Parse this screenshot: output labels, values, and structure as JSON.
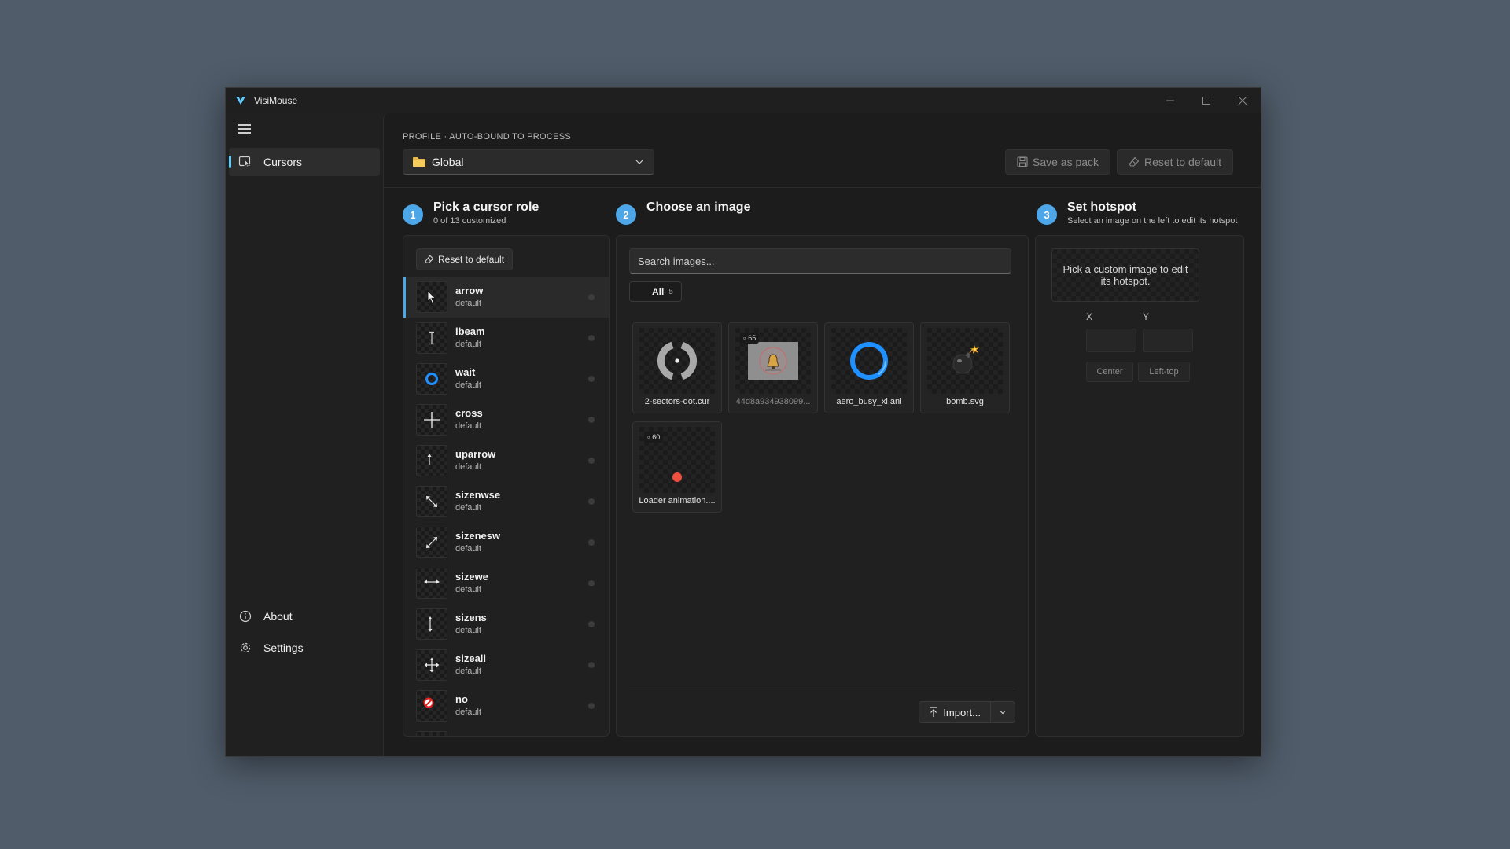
{
  "window": {
    "title": "VisiMouse",
    "accent": "#60cdff",
    "step_color": "#4ca6e8"
  },
  "sidebar": {
    "items": [
      {
        "label": "Cursors",
        "icon": "cursor-image-icon"
      }
    ],
    "footer": [
      {
        "label": "About",
        "icon": "info-icon"
      },
      {
        "label": "Settings",
        "icon": "gear-icon"
      }
    ]
  },
  "profile": {
    "label": "PROFILE · AUTO-BOUND TO PROCESS",
    "selected": "Global",
    "save_label": "Save as pack",
    "reset_label": "Reset to default"
  },
  "steps": [
    {
      "number": "1",
      "title": "Pick a cursor role",
      "subtitle": "0 of 13 customized"
    },
    {
      "number": "2",
      "title": "Choose an image",
      "subtitle": ""
    },
    {
      "number": "3",
      "title": "Set hotspot",
      "subtitle": "Select an image on the left to edit its hotspot"
    }
  ],
  "roles_panel": {
    "reset_label": "Reset to default",
    "roles": [
      {
        "name": "arrow",
        "state": "default",
        "icon": "arrow-cursor-icon"
      },
      {
        "name": "ibeam",
        "state": "default",
        "icon": "ibeam-cursor-icon"
      },
      {
        "name": "wait",
        "state": "default",
        "icon": "wait-ring-icon"
      },
      {
        "name": "cross",
        "state": "default",
        "icon": "cross-cursor-icon"
      },
      {
        "name": "uparrow",
        "state": "default",
        "icon": "uparrow-cursor-icon"
      },
      {
        "name": "sizenwse",
        "state": "default",
        "icon": "sizenwse-cursor-icon"
      },
      {
        "name": "sizenesw",
        "state": "default",
        "icon": "sizenesw-cursor-icon"
      },
      {
        "name": "sizewe",
        "state": "default",
        "icon": "sizewe-cursor-icon"
      },
      {
        "name": "sizens",
        "state": "default",
        "icon": "sizens-cursor-icon"
      },
      {
        "name": "sizeall",
        "state": "default",
        "icon": "sizeall-cursor-icon"
      },
      {
        "name": "no",
        "state": "default",
        "icon": "no-cursor-icon"
      }
    ]
  },
  "images_panel": {
    "search_placeholder": "Search images...",
    "filter_label": "All",
    "filter_count": "5",
    "images": [
      {
        "name": "2-sectors-dot.cur",
        "badge": "",
        "icon": "spinner-sectors-icon"
      },
      {
        "name": "44d8a934938099...",
        "badge": "65",
        "icon": "bell-thumbnail-icon"
      },
      {
        "name": "aero_busy_xl.ani",
        "badge": "",
        "icon": "busy-ring-icon"
      },
      {
        "name": "bomb.svg",
        "badge": "",
        "icon": "bomb-icon"
      },
      {
        "name": "Loader animation....",
        "badge": "60",
        "icon": "red-dot-icon"
      }
    ],
    "import_label": "Import..."
  },
  "hotspot_panel": {
    "hint": "Pick a custom image to edit its hotspot.",
    "x_label": "X",
    "y_label": "Y",
    "center_label": "Center",
    "lefttop_label": "Left-top"
  }
}
